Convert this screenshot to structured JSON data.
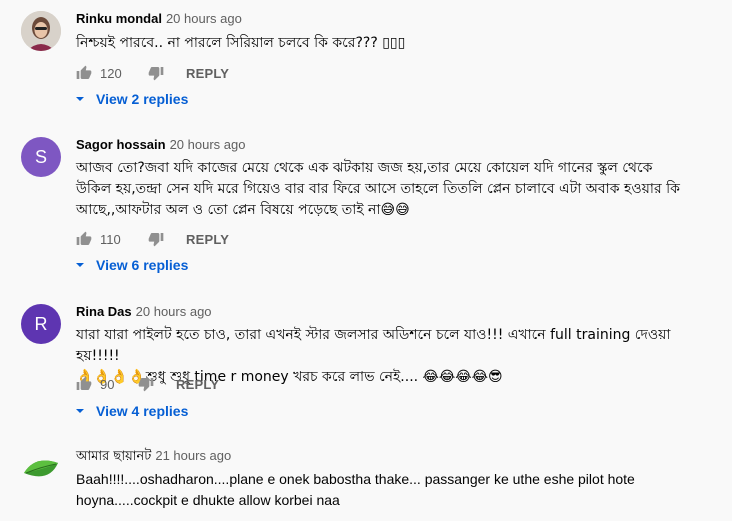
{
  "comments": [
    {
      "author": "Rinku mondal",
      "time": "20 hours ago",
      "avatar_type": "photo",
      "text_lines": [
        "নিশ্চয়ই পারবে.. না পারলে সিরিয়াল চলবে কি করে??? ▯▯▯"
      ],
      "likes": "120",
      "reply_label": "REPLY",
      "replies_label": "View 2 replies"
    },
    {
      "author": "Sagor hossain",
      "time": "20 hours ago",
      "avatar_type": "letter",
      "avatar_letter": "S",
      "avatar_color": "#7e57c2",
      "text_lines": [
        "আজব তো?জবা যদি কাজের মেয়ে থেকে এক ঝটকায় জজ হয়,তার মেয়ে কোয়েল যদি গানের স্কুল থেকে",
        "উকিল হয়,তন্দ্রা সেন যদি মরে গিয়েও বার বার ফিরে আসে তাহলে তিতলি প্লেন চালাবে এটা অবাক হওয়ার কি",
        "আছে,,আফটার অল ও তো প্লেন বিষয়ে পড়েছে তাই না😅😅"
      ],
      "likes": "110",
      "reply_label": "REPLY",
      "replies_label": "View 6 replies"
    },
    {
      "author": "Rina Das",
      "time": "20 hours ago",
      "avatar_type": "letter",
      "avatar_letter": "R",
      "avatar_color": "#5e35b1",
      "text_lines": [
        "যারা যারা পাইলট হতে চাও, তারা এখনই স্টার জলসার অডিশনে চলে যাও!!! এখানে full training দেওয়া হয়!!!!!",
        "👌👌👌👌শুধু শুধু time r money খরচ করে লাভ নেই.... 😂😂😂😂😎"
      ],
      "likes": "90",
      "reply_label": "REPLY",
      "replies_label": "View 4 replies"
    },
    {
      "author": "আমার ছায়ানট",
      "time": "21 hours ago",
      "avatar_type": "leaf",
      "text_lines": [
        "Baah!!!!....oshadharon....plane e onek babostha thake... passanger ke uthe eshe pilot hote",
        "hoyna.....cockpit e dhukte allow korbei naa"
      ]
    }
  ],
  "colors": {
    "link": "#065fd4",
    "secondary": "#606060",
    "icon": "#909090"
  }
}
